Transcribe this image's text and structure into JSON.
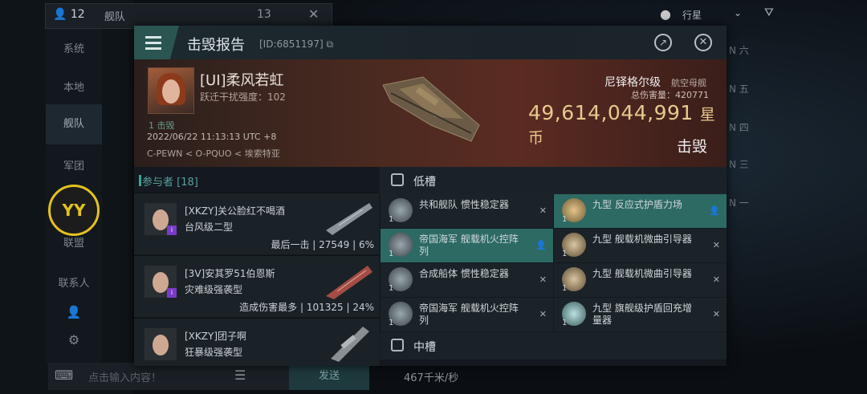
{
  "background": {
    "member_count": "12",
    "channel_tab": "舰队",
    "channel_count": "13",
    "channel_close": "✕",
    "nav": [
      "系统",
      "本地",
      "舰队",
      "军团",
      "联盟",
      "联系人"
    ],
    "nav_active": "舰队",
    "yy_logo": "YY",
    "chat_placeholder": "点击输入内容！",
    "send_label": "发送",
    "overview_filter": "行星",
    "speed_readout": "467千米/秒",
    "side_list": [
      "N 六",
      "N 五",
      "N 四",
      "N 三",
      "N 一"
    ]
  },
  "modal": {
    "title": "击毁报告",
    "report_id": "[ID:6851197]",
    "share_icon": "share-icon",
    "close_icon": "close-icon"
  },
  "victim": {
    "name": "[UI]柔风若虹",
    "warp_disruption": "跃迁干扰强度：102",
    "kills": "1 击毁",
    "datetime": "2022/06/22 11:13:13 UTC +8",
    "location": "C-PEWN < O-PQUO < 埃索特亚",
    "ship_name": "尼铎格尔级",
    "ship_class": "航空母舰",
    "total_damage": "总伤害量：420771",
    "isk_value": "49,614,044,991",
    "isk_unit": "星币",
    "result_tag": "击毁"
  },
  "participants": {
    "header": "参与者 [18]",
    "rows": [
      {
        "name": "[XKZY]关公脸红不喝酒",
        "ship": "台风级二型",
        "stats": "最后一击 | 27549 | 6%"
      },
      {
        "name": "[3V]安其罗51伯恩斯",
        "ship": "灾难级强袭型",
        "stats": "造成伤害最多 | 101325 | 24%"
      },
      {
        "name": "[XKZY]团子啊",
        "ship": "狂暴级强袭型",
        "stats": ""
      }
    ]
  },
  "slots": {
    "low_header": "低槽",
    "mid_header": "中槽",
    "low": [
      {
        "label": "共和舰队 惯性稳定器",
        "qty": "1",
        "highlight": false,
        "action": "✕"
      },
      {
        "label": "九型 反应式护盾力场",
        "qty": "1",
        "highlight": true,
        "action": "👤"
      },
      {
        "label": "帝国海军 舰载机火控阵列",
        "qty": "1",
        "highlight": true,
        "action": "👤"
      },
      {
        "label": "九型 舰载机微曲引导器",
        "qty": "1",
        "highlight": false,
        "action": "✕"
      },
      {
        "label": "合成船体 惯性稳定器",
        "qty": "1",
        "highlight": false,
        "action": "✕"
      },
      {
        "label": "九型 舰载机微曲引导器",
        "qty": "1",
        "highlight": false,
        "action": "✕"
      },
      {
        "label": "帝国海军 舰载机火控阵列",
        "qty": "1",
        "highlight": false,
        "action": "✕"
      },
      {
        "label": "九型 旗舰级护盾回充增量器",
        "qty": "1",
        "highlight": false,
        "action": "✕"
      }
    ]
  }
}
